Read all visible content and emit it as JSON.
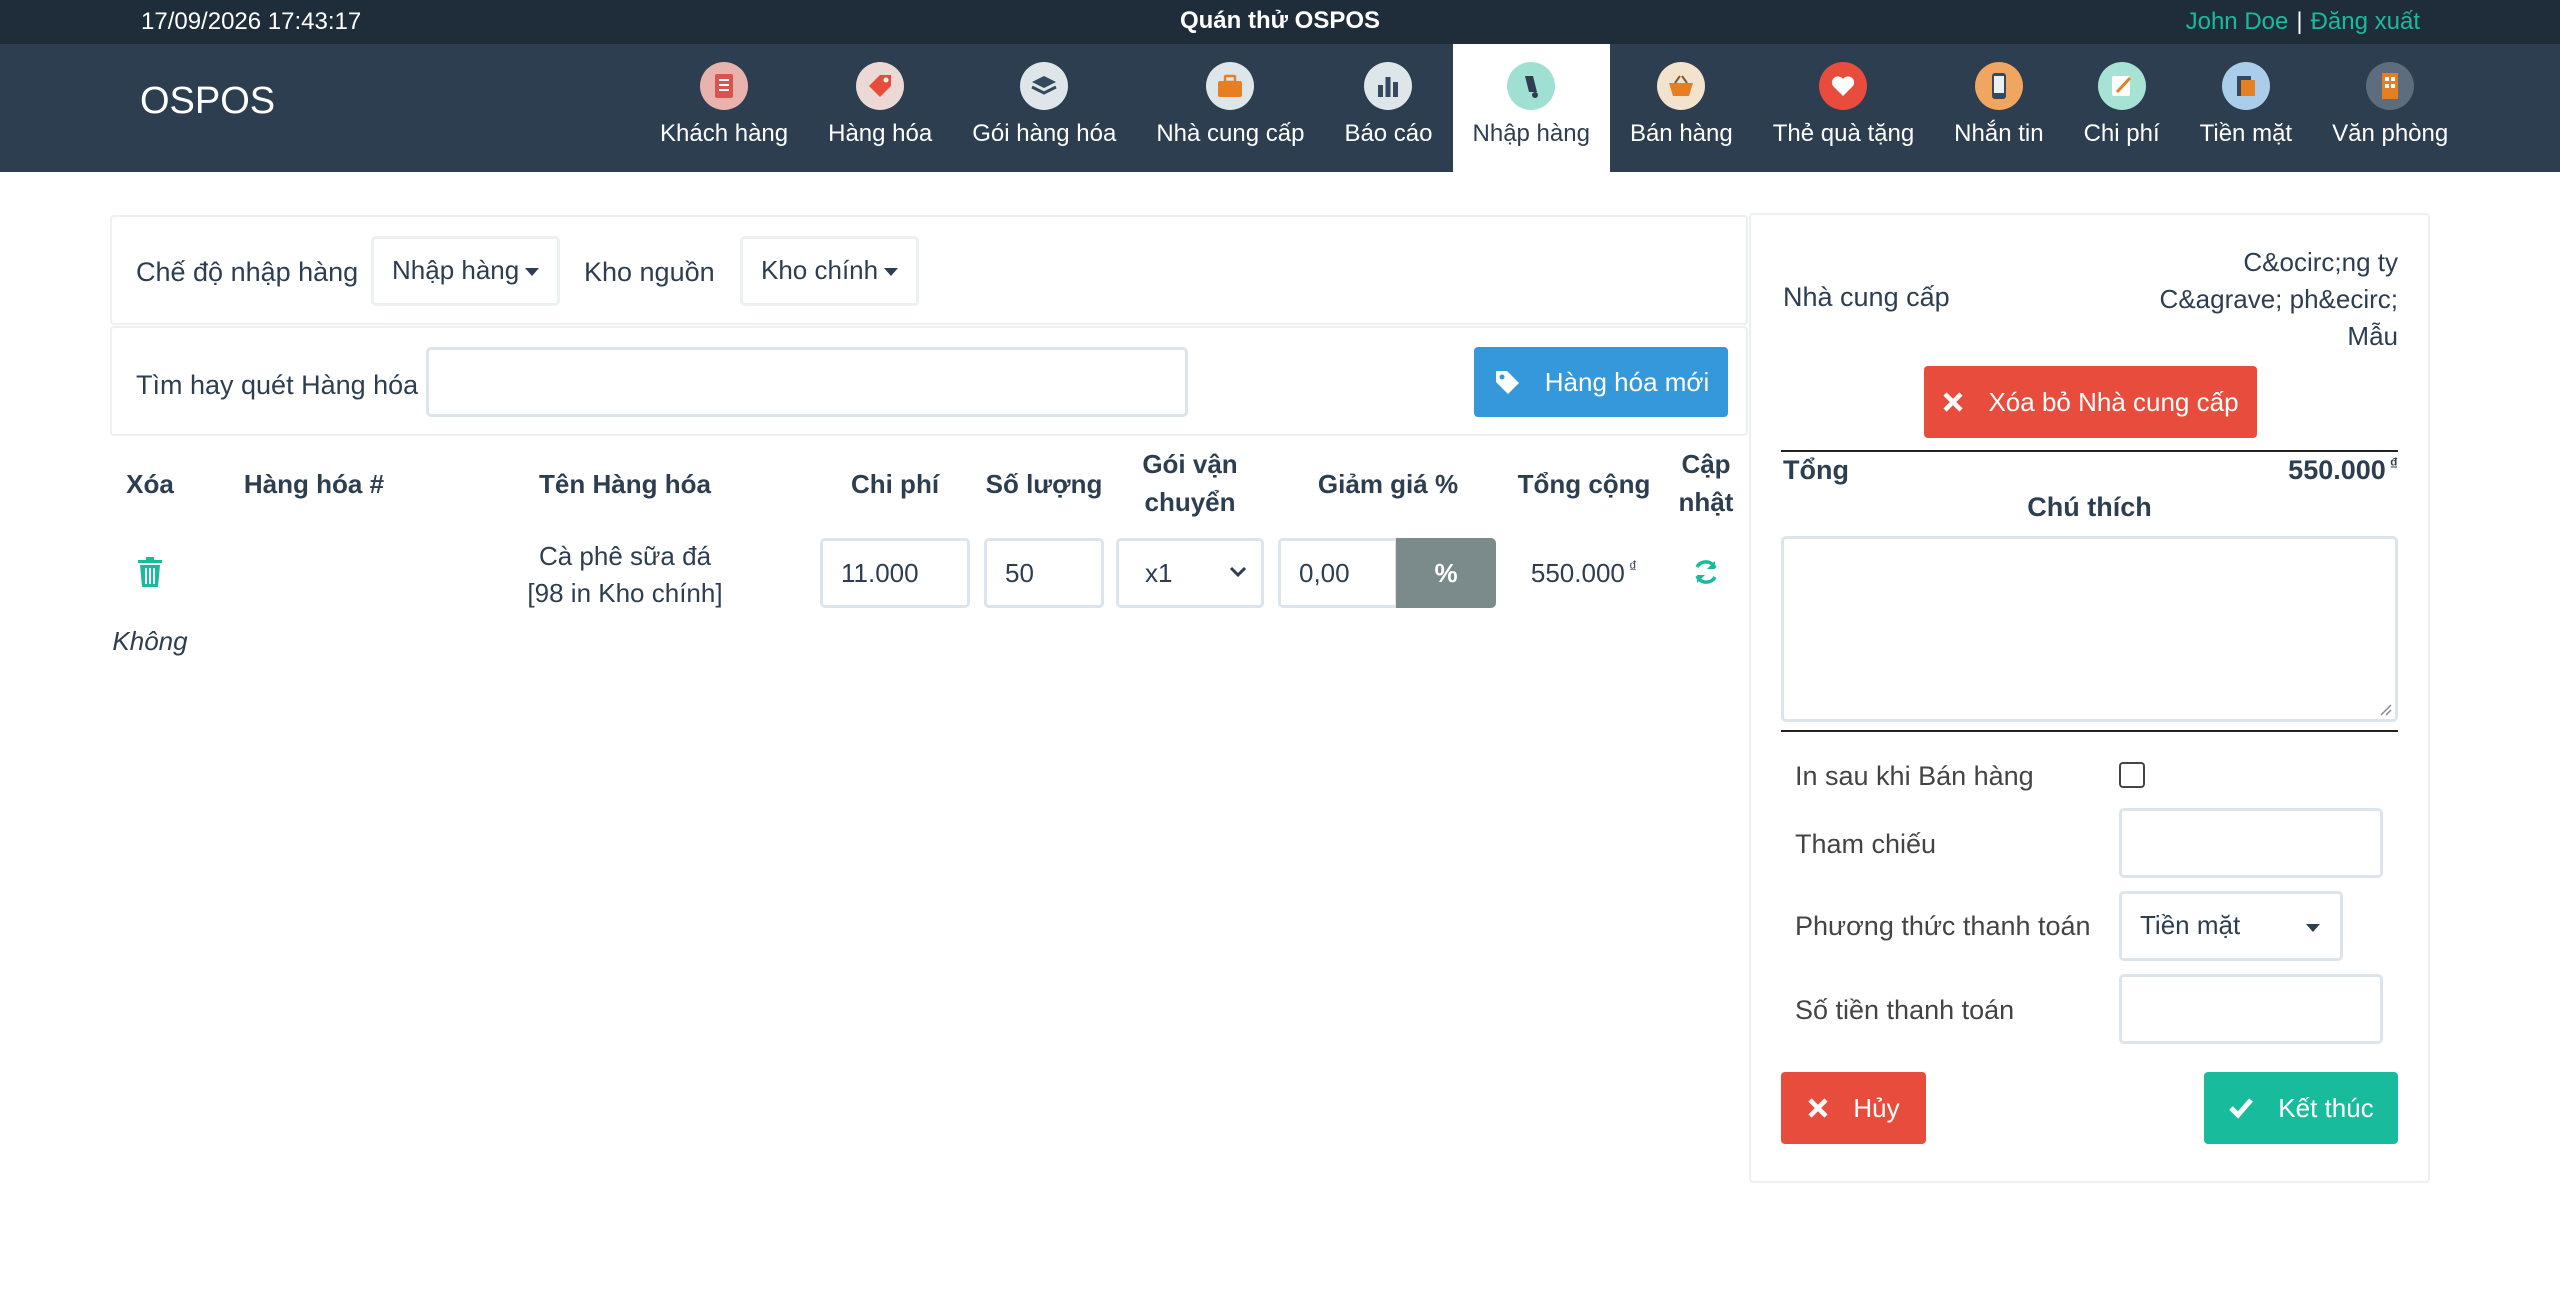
{
  "topbar": {
    "datetime": "17/09/2026 17:43:17",
    "store_name": "Quán thử OSPOS",
    "user": "John Doe",
    "separator": "|",
    "logout": "Đăng xuất"
  },
  "brand": "OSPOS",
  "nav": [
    {
      "label": "Khách hàng",
      "icon": "customers-icon",
      "color": "#d9534f"
    },
    {
      "label": "Hàng hóa",
      "icon": "items-tag-icon",
      "color": "#e74c3c"
    },
    {
      "label": "Gói hàng hóa",
      "icon": "item-kits-layers-icon",
      "color": "#34495e"
    },
    {
      "label": "Nhà cung cấp",
      "icon": "suppliers-briefcase-icon",
      "color": "#e67e22"
    },
    {
      "label": "Báo cáo",
      "icon": "reports-chart-icon",
      "color": "#34495e"
    },
    {
      "label": "Nhập hàng",
      "icon": "receivings-icon",
      "color": "#18bc9c",
      "active": true
    },
    {
      "label": "Bán hàng",
      "icon": "sales-basket-icon",
      "color": "#e67e22"
    },
    {
      "label": "Thẻ quà tặng",
      "icon": "giftcards-heart-icon",
      "color": "#e74c3c"
    },
    {
      "label": "Nhắn tin",
      "icon": "messages-phone-icon",
      "color": "#e67e22"
    },
    {
      "label": "Chi phí",
      "icon": "expenses-note-icon",
      "color": "#18bc9c"
    },
    {
      "label": "Tiền mặt",
      "icon": "cashups-icon",
      "color": "#3498db"
    },
    {
      "label": "Văn phòng",
      "icon": "office-icon",
      "color": "#e67e22"
    }
  ],
  "mode": {
    "mode_label": "Chế độ nhập hàng",
    "mode_value": "Nhập hàng",
    "stock_label": "Kho nguồn",
    "stock_value": "Kho chính"
  },
  "search": {
    "label": "Tìm hay quét Hàng hóa",
    "value": "",
    "new_item_button": "Hàng hóa mới"
  },
  "table": {
    "headers": {
      "delete": "Xóa",
      "item_number": "Hàng hóa #",
      "name": "Tên Hàng hóa",
      "cost": "Chi phí",
      "quantity": "Số lượng",
      "ship_pack_1": "Gói vận",
      "ship_pack_2": "chuyển",
      "discount": "Giảm giá %",
      "total": "Tổng cộng",
      "update_1": "Cập",
      "update_2": "nhật"
    },
    "rows": [
      {
        "name_line1": "Cà phê sữa đá",
        "name_line2": "[98 in Kho chính]",
        "cost": "11.000",
        "quantity": "50",
        "ship_pack": "x1",
        "discount": "0,00",
        "discount_addon": "%",
        "total": "550.000",
        "currency": "₫",
        "note": "Không"
      }
    ]
  },
  "summary": {
    "supplier_label": "Nhà cung cấp",
    "supplier_line1": "C&ocirc;ng ty",
    "supplier_line2": "C&agrave; ph&ecirc;",
    "supplier_line3": "Mẫu",
    "remove_supplier_button": "Xóa bỏ Nhà cung cấp",
    "total_label": "Tổng",
    "total_value": "550.000",
    "currency": "₫",
    "comment_label": "Chú thích",
    "comment_value": "",
    "print_after_sale_label": "In sau khi Bán hàng",
    "print_after_sale_checked": false,
    "reference_label": "Tham chiếu",
    "reference_value": "",
    "payment_type_label": "Phương thức thanh toán",
    "payment_type_value": "Tiền mặt",
    "amount_tendered_label": "Số tiền thanh toán",
    "amount_tendered_value": "",
    "cancel_button": "Hủy",
    "complete_button": "Kết thúc"
  }
}
